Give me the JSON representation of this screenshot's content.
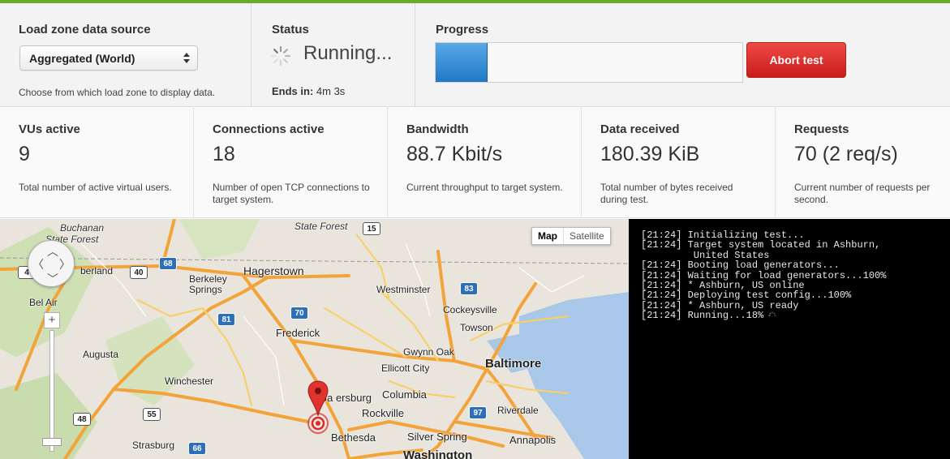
{
  "source": {
    "title": "Load zone data source",
    "selected": "Aggregated (World)",
    "hint": "Choose from which load zone to display data."
  },
  "status": {
    "title": "Status",
    "text": "Running...",
    "ends_label": "Ends in:",
    "ends_value": " 4m 3s"
  },
  "progress": {
    "title": "Progress",
    "fraction": 0.17,
    "abort_label": "Abort test"
  },
  "stats": [
    {
      "label": "VUs active",
      "value": "9",
      "desc": "Total number of active virtual users."
    },
    {
      "label": "Connections active",
      "value": "18",
      "desc": "Number of open TCP connections to target system."
    },
    {
      "label": "Bandwidth",
      "value": "88.7 Kbit/s",
      "desc": "Current throughput to target system."
    },
    {
      "label": "Data received",
      "value": "180.39 KiB",
      "desc": "Total number of bytes received during test."
    },
    {
      "label": "Requests",
      "value": "70 (2 req/s)",
      "desc": "Current number of requests per second."
    }
  ],
  "map": {
    "type_map": "Map",
    "type_satellite": "Satellite",
    "zoom_in": "+",
    "labels": {
      "buchanan": "Buchanan",
      "state_forest_1": "State Forest",
      "state_forest_2": "State Forest",
      "berland": "berland",
      "hagerstown": "Hagerstown",
      "berkeley": "Berkeley",
      "springs": "Springs",
      "westminster": "Westminster",
      "bel_air": "Bel Air",
      "cockeysville": "Cockeysville",
      "frederick": "Frederick",
      "towson": "Towson",
      "augusta": "Augusta",
      "gwynn_oak": "Gwynn Oak",
      "baltimore": "Baltimore",
      "ellicott_city": "Ellicott City",
      "winchester": "Winchester",
      "gaithersburg": "Ga     ersburg",
      "columbia": "Columbia",
      "rockville": "Rockville",
      "riverdale": "Riverdale",
      "bethesda": "Bethesda",
      "silver_spring": "Silver Spring",
      "annapolis": "Annapolis",
      "strasburg": "Strasburg",
      "washington": "Washington"
    },
    "shields": {
      "s15": "15",
      "s68": "68",
      "s40": "40",
      "s4": "4",
      "s83": "83",
      "s70": "70",
      "s81": "81",
      "s97": "97",
      "s48": "48",
      "s55": "55",
      "s66": "66"
    }
  },
  "console": {
    "lines": [
      "[21:24] Initializing test...",
      "[21:24] Target system located in Ashburn,",
      "         United States",
      "[21:24] Booting load generators...",
      "[21:24] Waiting for load generators...100%",
      "[21:24] * Ashburn, US online",
      "[21:24] Deploying test config...100%",
      "[21:24] * Ashburn, US ready",
      "[21:24] Running...18%"
    ]
  },
  "colors": {
    "accent_green": "#6aab2e",
    "progress_blue": "#2a85d0",
    "abort_red": "#d9271f"
  }
}
